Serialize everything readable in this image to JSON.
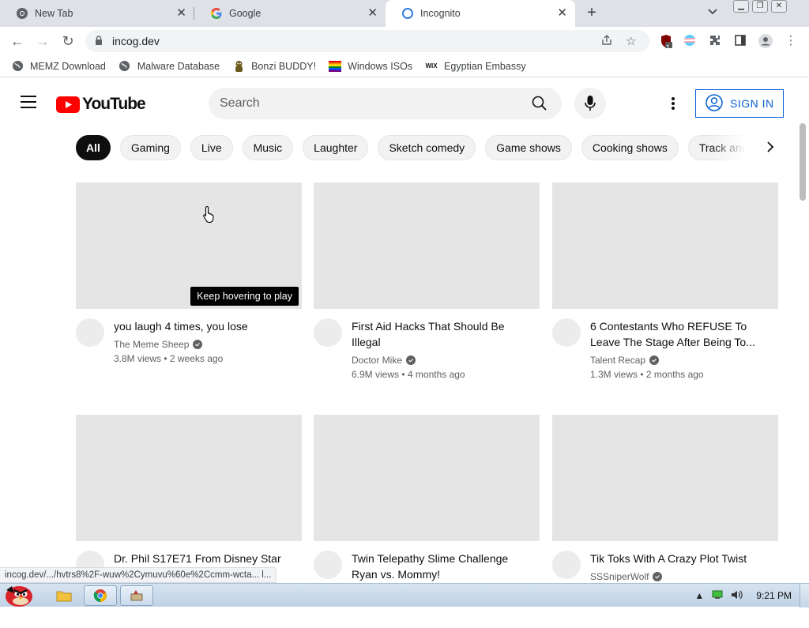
{
  "browser": {
    "tabs": [
      {
        "title": "New Tab",
        "active": false
      },
      {
        "title": "Google",
        "active": false
      },
      {
        "title": "Incognito",
        "active": true
      }
    ],
    "url": "incog.dev",
    "bookmarks": [
      {
        "label": "MEMZ Download"
      },
      {
        "label": "Malware Database"
      },
      {
        "label": "Bonzi BUDDY!"
      },
      {
        "label": "Windows ISOs"
      },
      {
        "label": "Egyptian Embassy"
      }
    ],
    "extension_badge": "1",
    "status_url": "incog.dev/.../hvtrs8%2F-wuw%2Cymuvu%60e%2Ccmm-wcta... l..."
  },
  "youtube": {
    "logo_text": "YouTube",
    "search_placeholder": "Search",
    "sign_in_label": "SIGN IN",
    "chips": [
      "All",
      "Gaming",
      "Live",
      "Music",
      "Laughter",
      "Sketch comedy",
      "Game shows",
      "Cooking shows",
      "Track and"
    ],
    "hover_tip": "Keep hovering to play",
    "videos": [
      {
        "title": "you laugh 4 times, you lose",
        "channel": "The Meme Sheep",
        "stats": "3.8M views • 2 weeks ago"
      },
      {
        "title": "First Aid Hacks That Should Be Illegal",
        "channel": "Doctor Mike",
        "stats": "6.9M views • 4 months ago"
      },
      {
        "title": "6 Contestants Who REFUSE To Leave The Stage After Being To...",
        "channel": "Talent Recap",
        "stats": "1.3M views • 2 months ago"
      },
      {
        "title": "Dr. Phil S17E71 From Disney Star",
        "channel": "",
        "stats": ""
      },
      {
        "title": "Twin Telepathy Slime Challenge Ryan vs. Mommy!",
        "channel": "",
        "stats": ""
      },
      {
        "title": "Tik Toks With A Crazy Plot Twist",
        "channel": "SSSniperWolf",
        "stats": ""
      }
    ]
  },
  "taskbar": {
    "clock": "9:21 PM"
  },
  "colors": {
    "youtube_red": "#ff0000",
    "signin_blue": "#065fd4",
    "chip_active": "#0f0f0f",
    "thumb_placeholder": "#e5e5e5"
  }
}
